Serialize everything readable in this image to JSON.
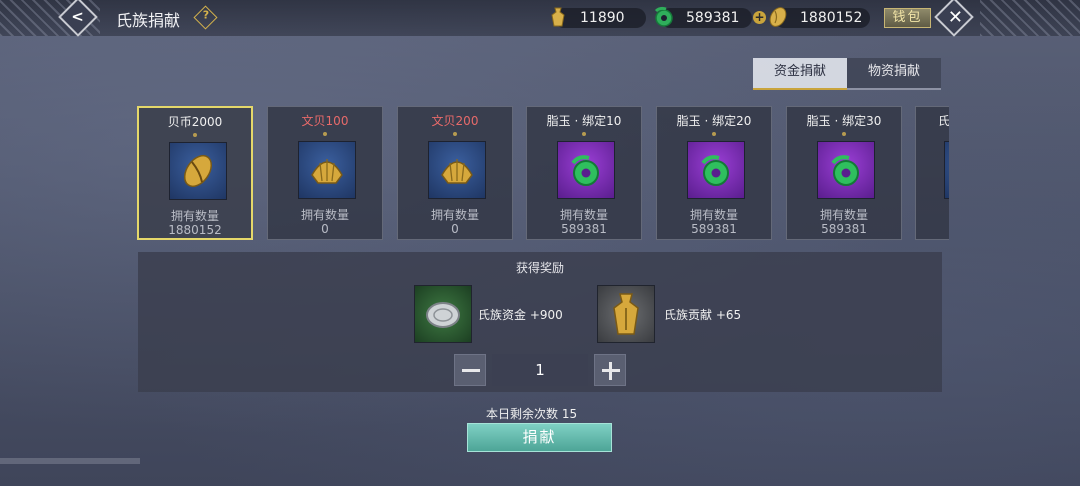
{
  "header": {
    "title": "氏族捐献",
    "help_label": "?",
    "currencies": [
      {
        "icon": "gold-bell-coin-icon",
        "value": "11890"
      },
      {
        "icon": "jade-ring-icon",
        "value": "589381"
      },
      {
        "icon": "gold-shell-icon",
        "value": "1880152"
      }
    ],
    "wallet_label": "钱包"
  },
  "tabs": [
    {
      "label": "资金捐献",
      "active": true
    },
    {
      "label": "物资捐献",
      "active": false
    }
  ],
  "cards": [
    {
      "name": "贝币2000",
      "name_color": "white",
      "icon": "gold-cowrie-shell-icon",
      "owned_label": "拥有数量",
      "count": "1880152",
      "selected": true
    },
    {
      "name": "文贝100",
      "name_color": "red",
      "icon": "gold-scallop-shell-icon",
      "owned_label": "拥有数量",
      "count": "0",
      "selected": false
    },
    {
      "name": "文贝200",
      "name_color": "red",
      "icon": "gold-scallop-shell-icon",
      "owned_label": "拥有数量",
      "count": "0",
      "selected": false
    },
    {
      "name": "脂玉 · 绑定10",
      "name_color": "white",
      "icon": "jade-ring-icon",
      "owned_label": "拥有数量",
      "count": "589381",
      "selected": false
    },
    {
      "name": "脂玉 · 绑定20",
      "name_color": "white",
      "icon": "jade-ring-icon",
      "owned_label": "拥有数量",
      "count": "589381",
      "selected": false
    },
    {
      "name": "脂玉 · 绑定30",
      "name_color": "white",
      "icon": "jade-ring-icon",
      "owned_label": "拥有数量",
      "count": "589381",
      "selected": false
    },
    {
      "name": "氏",
      "name_color": "white",
      "icon": "partial-card-icon",
      "owned_label": "",
      "count": "",
      "selected": false
    }
  ],
  "rewards": {
    "title": "获得奖励",
    "items": [
      {
        "icon": "silver-coin-icon",
        "text": "氏族资金 +900"
      },
      {
        "icon": "gold-bell-coin-icon",
        "text": "氏族贡献 +65"
      }
    ]
  },
  "stepper": {
    "value": "1"
  },
  "remaining": {
    "text": "本日剩余次数  15"
  },
  "donate_button": {
    "label": "捐献"
  },
  "colors": {
    "accent_gold": "#c9a43c",
    "selected_border": "#e5d86a",
    "donate_button": "#5fb8aa",
    "red_text": "#e76a6a"
  }
}
